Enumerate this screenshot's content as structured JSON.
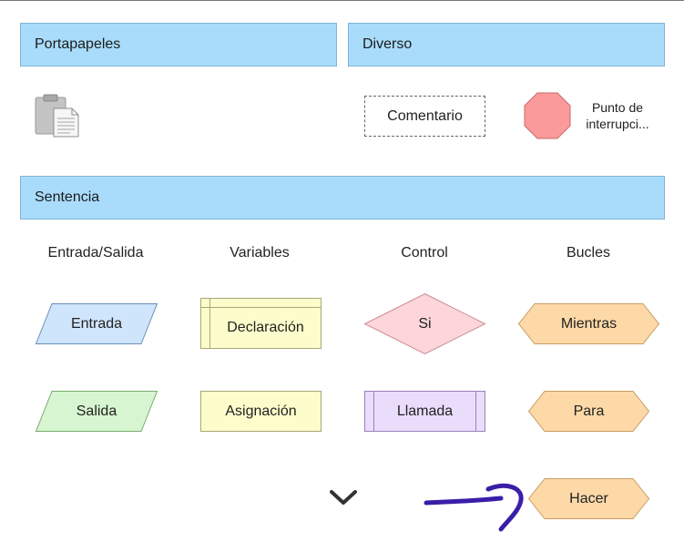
{
  "clipboard": {
    "header": "Portapapeles",
    "icon": "clipboard-paste-icon"
  },
  "misc": {
    "header": "Diverso",
    "comment_label": "Comentario",
    "breakpoint_line1": "Punto de",
    "breakpoint_line2": "interrupci...",
    "breakpoint_color": "#fb9a9a"
  },
  "statements": {
    "header": "Sentencia",
    "columns": [
      "Entrada/Salida",
      "Variables",
      "Control",
      "Bucles"
    ],
    "io": {
      "input": "Entrada",
      "output": "Salida"
    },
    "variables": {
      "declaration": "Declaración",
      "assignment": "Asignación"
    },
    "control": {
      "if": "Si",
      "call": "Llamada"
    },
    "loops": {
      "while": "Mientras",
      "for": "Para",
      "do": "Hacer"
    }
  },
  "scroll_indicator": "chevron-down-icon",
  "colors": {
    "header_bg": "#a9dcfb",
    "input_fill": "#cfe5fb",
    "output_fill": "#d6f5d0",
    "variable_fill": "#fdfdcc",
    "if_fill": "#fcd6d9",
    "call_fill": "#eadcfb",
    "loop_fill": "#fdd9a8",
    "annotation_stroke": "#3b1ea8"
  }
}
